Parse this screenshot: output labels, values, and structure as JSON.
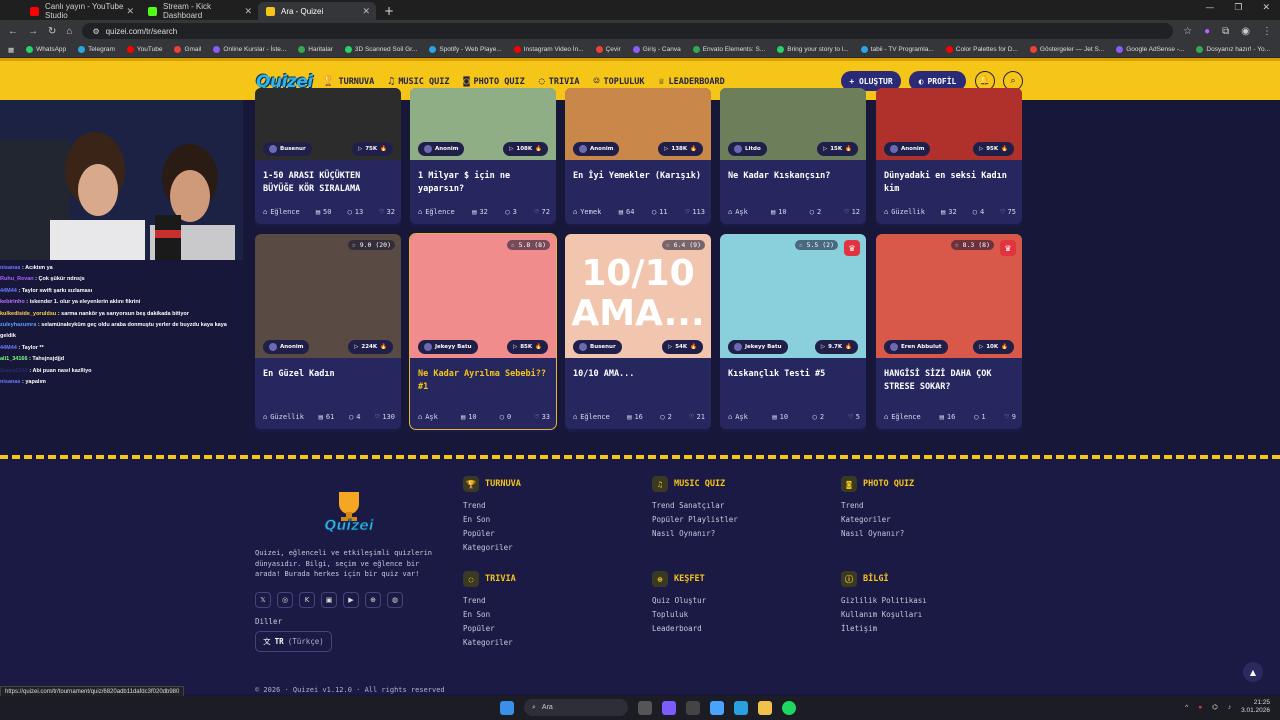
{
  "browser": {
    "tabs": [
      {
        "label": "Canlı yayın - YouTube Studio",
        "color": "#ff0000"
      },
      {
        "label": "Stream - Kick Dashboard",
        "color": "#53fc18"
      },
      {
        "label": "Ara - Quizei",
        "color": "#f5c518"
      }
    ],
    "url": "quizei.com/tr/search",
    "bookmarks": [
      "WhatsApp",
      "Telegram",
      "YouTube",
      "Gmail",
      "Online Kurslar - İste...",
      "Haritalar",
      "3D Scanned Soil Gr...",
      "Spotify - Web Playe...",
      "Instagram Video İn...",
      "Çevir",
      "Giriş - Canva",
      "Envato Elements: S...",
      "Bring your story to l...",
      "tabii - TV Programla...",
      "Color Palettes for D...",
      "Göstergeler — Jet S...",
      "Google AdSense -...",
      "Dosyanız hazır! - Yo..."
    ],
    "all_bookmarks": "Tüm Yer İşaretleri"
  },
  "site": {
    "logo": "Quizei",
    "nav": [
      {
        "label": "TURNUVA",
        "icon": "🏆"
      },
      {
        "label": "MUSIC QUIZ",
        "icon": "♫"
      },
      {
        "label": "PHOTO QUIZ",
        "icon": "◙"
      },
      {
        "label": "TRIVIA",
        "icon": "◌"
      },
      {
        "label": "TOPLULUK",
        "icon": "☺"
      },
      {
        "label": "LEADERBOARD",
        "icon": "♕"
      }
    ],
    "create_label": "+ OLUŞTUR",
    "profile_label": "PROFİL"
  },
  "chat": [
    {
      "user": "nisanas",
      "color": "#6c7bff",
      "msg": "Acıktım ya"
    },
    {
      "user": "Ruhu_Revan",
      "color": "#b05cff",
      "msg": "Çok şükür ndnsjs"
    },
    {
      "user": "44M44",
      "color": "#6c7bff",
      "msg": "Taylor swift şarkı sızlaması"
    },
    {
      "user": "kebirinho",
      "color": "#c070ff",
      "msg": "iskender 1. olur ya eleyenlerin aklını fikrini"
    },
    {
      "user": "kulkediside_yoruldsu",
      "color": "#ffd24a",
      "msg": "sarma nankör ya sarıyorsun beş dakikada bitiyor"
    },
    {
      "user": "zuleyhazumra",
      "color": "#5aa0ff",
      "msg": "selamünaleyküm geç oldu araba donmuştu yerler de buyzdu kaya kaya"
    },
    {
      "user": "",
      "color": "#fff",
      "msg": "geldik"
    },
    {
      "user": "44M44",
      "color": "#6c7bff",
      "msg": "Taylor **"
    },
    {
      "user": "ali1_34166",
      "color": "#7cff7c",
      "msg": "Tahsjnsjdjjd"
    },
    {
      "user": "Supra2243",
      "color": "#2a2a6a",
      "msg": "Abi puan nasıl kazlliyo"
    },
    {
      "user": "nisanas",
      "color": "#6c7bff",
      "msg": "yapalım"
    }
  ],
  "cards_row1": [
    {
      "author": "Busenur",
      "plays": "75K",
      "title": "1-50 ARASI KÜÇÜKTEN BÜYÜĞE KÖR SIRALAMA",
      "category": "Eğlence",
      "count": "50",
      "comments": "13",
      "likes": "32",
      "bg": "#2c2c2c"
    },
    {
      "author": "Anonim",
      "plays": "108K",
      "title": "1 Milyar $ için ne yaparsın?",
      "category": "Eğlence",
      "count": "32",
      "comments": "3",
      "likes": "72",
      "bg": "#8fae86"
    },
    {
      "author": "Anonim",
      "plays": "138K",
      "title": "En İyi Yemekler (Karışık)",
      "category": "Yemek",
      "count": "64",
      "comments": "11",
      "likes": "113",
      "bg": "#c9884a"
    },
    {
      "author": "Litdo",
      "plays": "15K",
      "title": "Ne Kadar Kıskançsın?",
      "category": "Aşk",
      "count": "10",
      "comments": "2",
      "likes": "12",
      "bg": "#6c7e5a"
    },
    {
      "author": "Anonim",
      "plays": "95K",
      "title": "Dünyadaki en seksi Kadın kim",
      "category": "Güzellik",
      "count": "32",
      "comments": "4",
      "likes": "75",
      "bg": "#b0302c"
    }
  ],
  "cards_row2": [
    {
      "rating": "9.0 (20)",
      "author": "Anonim",
      "plays": "224K",
      "title": "En Güzel Kadın",
      "category": "Güzellik",
      "count": "61",
      "comments": "4",
      "likes": "130",
      "bg": "#5a4a44",
      "crown": false
    },
    {
      "rating": "5.8 (8)",
      "author": "Jekeyy Batu",
      "plays": "85K",
      "title": "Ne Kadar Ayrılma Sebebi?? #1",
      "category": "Aşk",
      "count": "10",
      "comments": "0",
      "likes": "33",
      "bg": "#f08c8c",
      "crown": false
    },
    {
      "rating": "6.4 (9)",
      "author": "Busenur",
      "plays": "54K",
      "title": "10/10 AMA...",
      "category": "Eğlence",
      "count": "16",
      "comments": "2",
      "likes": "21",
      "bg": "#f2c5ae",
      "crown": false,
      "big_text": "10/10 AMA..."
    },
    {
      "rating": "5.5 (2)",
      "author": "Jekeyy Batu",
      "plays": "9.7K",
      "title": "Kıskançlık Testi #5",
      "category": "Aşk",
      "count": "10",
      "comments": "2",
      "likes": "5",
      "bg": "#8ad0dc",
      "crown": true
    },
    {
      "rating": "8.3 (8)",
      "author": "Eren Abbulut",
      "plays": "10K",
      "title": "HANGİSİ SİZİ DAHA ÇOK STRESE SOKAR?",
      "category": "Eğlence",
      "count": "16",
      "comments": "1",
      "likes": "9",
      "bg": "#d8584a",
      "crown": true
    }
  ],
  "footer": {
    "about": "Quizei, eğlenceli ve etkileşimli quizlerin dünyasıdır. Bilgi, seçim ve eğlence bir arada! Burada herkes için bir quiz var!",
    "lang_label": "Diller",
    "lang_code": "TR",
    "lang_name": "(Türkçe)",
    "cols": [
      {
        "title": "TURNUVA",
        "icon": "🏆",
        "links": [
          "Trend",
          "En Son",
          "Popüler",
          "Kategoriler"
        ]
      },
      {
        "title": "MUSIC QUIZ",
        "icon": "♫",
        "links": [
          "Trend Sanatçılar",
          "Popüler Playlistler",
          "Nasıl Oynanır?"
        ]
      },
      {
        "title": "PHOTO QUIZ",
        "icon": "◙",
        "links": [
          "Trend",
          "Kategoriler",
          "Nasıl Oynanır?"
        ]
      },
      {
        "title": "TRIVIA",
        "icon": "◌",
        "links": [
          "Trend",
          "En Son",
          "Popüler",
          "Kategoriler"
        ]
      },
      {
        "title": "KEŞFET",
        "icon": "⊕",
        "links": [
          "Quiz Oluştur",
          "Topluluk",
          "Leaderboard"
        ]
      },
      {
        "title": "BİLGİ",
        "icon": "ⓘ",
        "links": [
          "Gizlilik Politikası",
          "Kullanım Koşulları",
          "İletişim"
        ]
      }
    ],
    "copyright": "© 2026 · Quizei v1.12.0 · All rights reserved"
  },
  "status_url": "https://quizei.com/tr/tournament/quiz/6820adb11dafdc3f020db980",
  "taskbar": {
    "search": "Ara",
    "time": "21:25",
    "date": "3.01.2026"
  }
}
